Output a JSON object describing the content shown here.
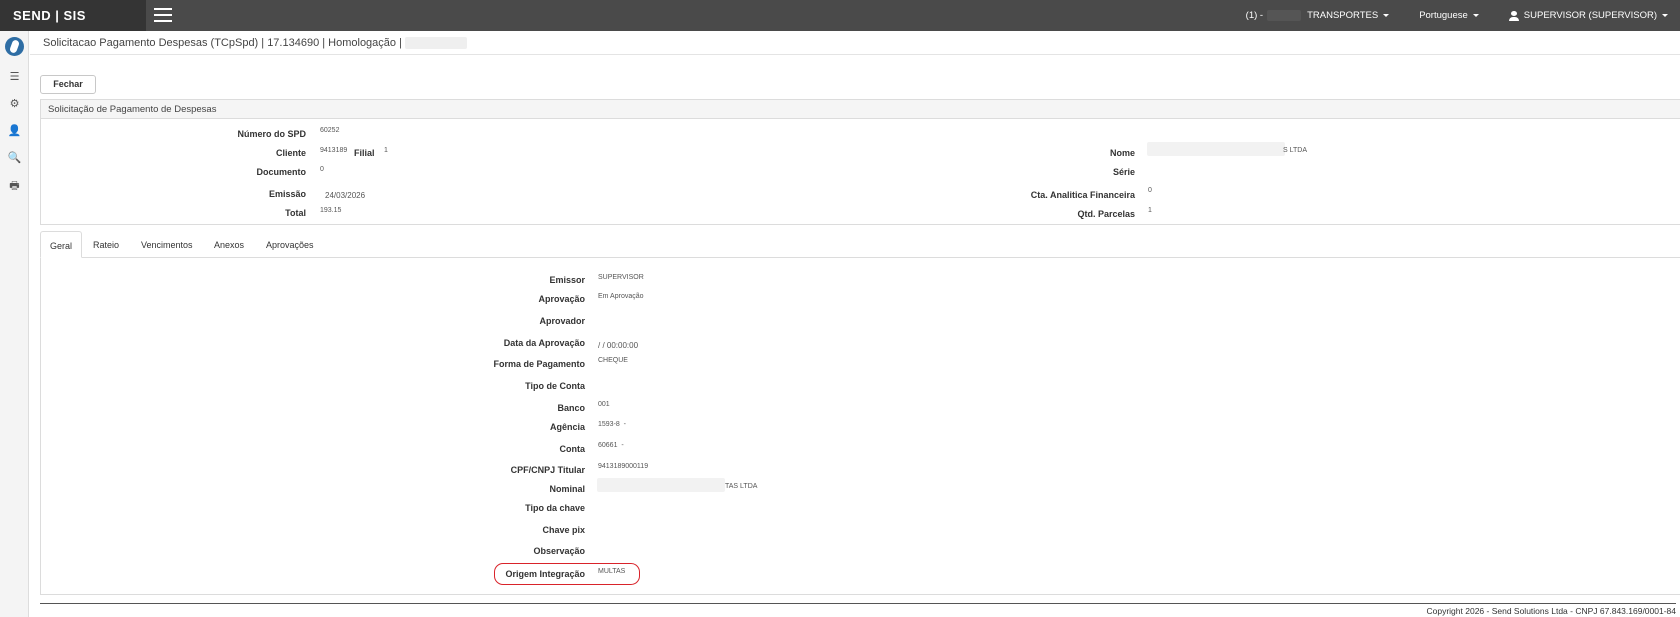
{
  "topbar": {
    "brand": "SEND | SIS",
    "company_prefix": "(1) -",
    "company": "TRANSPORTES",
    "language": "Portuguese",
    "user": "SUPERVISOR (SUPERVISOR)"
  },
  "sidebar": {
    "items": [
      {
        "icon": "list-icon",
        "glyph": "☰"
      },
      {
        "icon": "cogs-icon",
        "glyph": "⚙"
      },
      {
        "icon": "add-user-icon",
        "glyph": "👤"
      },
      {
        "icon": "search-icon",
        "glyph": "🔍"
      },
      {
        "icon": "print-icon",
        "glyph": "🖶"
      }
    ]
  },
  "page": {
    "title": "Solicitacao Pagamento Despesas (TCpSpd) | 17.134690 | Homologação |",
    "close_button": "Fechar",
    "panel_title": "Solicitação de Pagamento de Despesas"
  },
  "header_fields": {
    "numero_label": "Número do SPD",
    "numero_value": "60252",
    "cliente_label": "Cliente",
    "cliente_value": "9413189",
    "filial_label": "Filial",
    "filial_value": "1",
    "documento_label": "Documento",
    "documento_value": "0",
    "emissao_label": "Emissão",
    "emissao_value": "24/03/2026",
    "total_label": "Total",
    "total_value": "193.15",
    "nome_label": "Nome",
    "nome_value": "S LTDA",
    "serie_label": "Série",
    "cta_label": "Cta. Analitica Financeira",
    "cta_value": "0",
    "parcelas_label": "Qtd. Parcelas",
    "parcelas_value": "1"
  },
  "tabs": [
    "Geral",
    "Rateio",
    "Vencimentos",
    "Anexos",
    "Aprovações"
  ],
  "geral": {
    "emissor_label": "Emissor",
    "emissor_value": "SUPERVISOR",
    "aprovacao_label": "Aprovação",
    "aprovacao_value": "Em Aprovação",
    "aprovador_label": "Aprovador",
    "data_aprovacao_label": "Data da Aprovação",
    "data_aprovacao_value": "/ / 00:00:00",
    "forma_label": "Forma de Pagamento",
    "forma_value": "CHEQUE",
    "tipo_conta_label": "Tipo de Conta",
    "banco_label": "Banco",
    "banco_value": "001",
    "agencia_label": "Agência",
    "agencia_value": "1593-8  -",
    "conta_label": "Conta",
    "conta_value": "60661  -",
    "cpf_label": "CPF/CNPJ Titular",
    "cpf_value": "9413189000119",
    "nominal_label": "Nominal",
    "nominal_value": "TAS LTDA",
    "tipo_chave_label": "Tipo da chave",
    "chave_label": "Chave pix",
    "observacao_label": "Observação",
    "origem_label": "Origem Integração",
    "origem_value": "MULTAS"
  },
  "footer": {
    "text": "Copyright 2026 - Send Solutions Ltda - CNPJ 67.843.169/0001-84"
  },
  "colors": {
    "navbar": "#4a4a4a",
    "brand_bg": "#343434",
    "highlight": "#d9232a"
  }
}
